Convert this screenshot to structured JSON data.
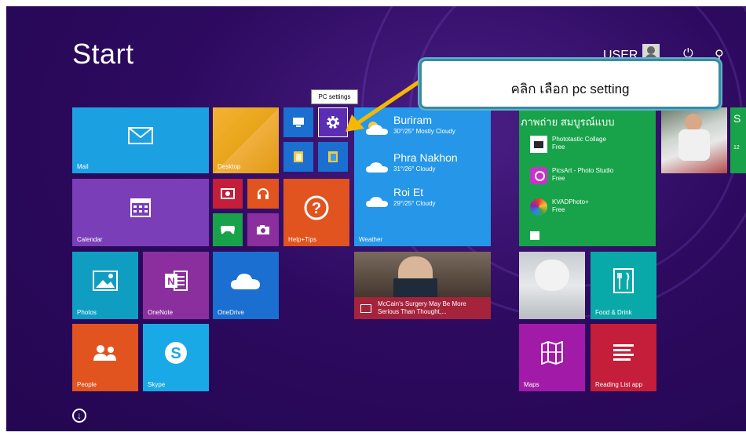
{
  "screen": {
    "title": "Start",
    "user": "USER"
  },
  "tooltip": "PC settings",
  "callout": "คลิก เลือก pc setting",
  "tiles": {
    "mail": "Mail",
    "calendar": "Calendar",
    "photos": "Photos",
    "onenote": "OneNote",
    "onedrive": "OneDrive",
    "people": "People",
    "skype": "Skype",
    "desktop": "Desktop",
    "help": "Help+Tips",
    "weather": "Weather",
    "food": "Food & Drink",
    "maps": "Maps",
    "reading": "Reading List app"
  },
  "weather": [
    {
      "city": "Buriram",
      "cond": "30°/25° Mostly Cloudy"
    },
    {
      "city": "Phra Nakhon",
      "cond": "31°/26° Cloudy"
    },
    {
      "city": "Roi Et",
      "cond": "29°/25° Cloudy"
    }
  ],
  "news": "McCain's Surgery May Be More Serious Than Thought,...",
  "store": {
    "heading": "ภาพถ่าย สมบูรณ์แบบ",
    "items": [
      {
        "name": "Phototastic Collage",
        "price": "Free"
      },
      {
        "name": "PicsArt - Photo Studio",
        "price": "Free"
      },
      {
        "name": "KVADPhoto+",
        "price": "Free"
      }
    ]
  },
  "edge_tile": {
    "letter": "S",
    "partial": "12"
  },
  "icons": [
    "mail-icon",
    "calendar-icon",
    "photos-icon",
    "onenote-icon",
    "onedrive-icon",
    "people-icon",
    "skype-icon",
    "gear-icon",
    "help-icon",
    "power-icon",
    "search-icon",
    "scroll-down-icon"
  ],
  "colors": {
    "background": "#2d0a5f",
    "mail": "#1ba1e2",
    "calendar": "#7a3fb8",
    "photos": "#0f9ec2",
    "onenote": "#8b2f9e",
    "onedrive": "#1a6fd0",
    "people": "#e1531f",
    "skype": "#19a9e6",
    "desktop": "#e8a51a",
    "help": "#e1531f",
    "weather": "#2596e8",
    "store": "#18a34a",
    "food": "#0aa9a9",
    "maps": "#a21aa8",
    "reading": "#c41e3a",
    "callout_border": "#3d8aa0",
    "arrow": "#f5b800"
  }
}
